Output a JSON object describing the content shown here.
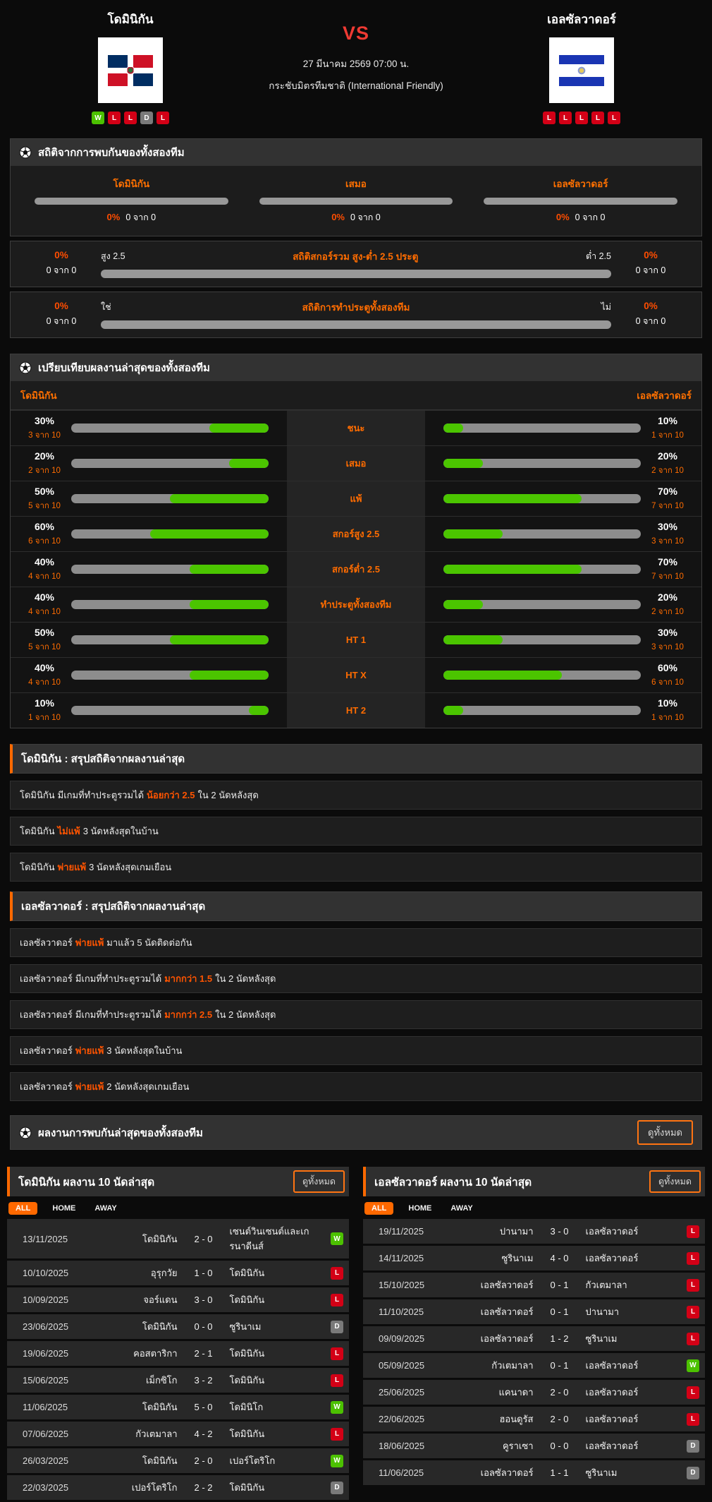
{
  "colors": {
    "accent": "#ff6900",
    "percent": "#ff4d00",
    "win": "#4cc101",
    "loss": "#d30016",
    "draw": "#7a7a7a",
    "bar_green": "#4bc500",
    "bar_gray": "#8d8d8d",
    "vs_red": "#ef3a33"
  },
  "header": {
    "home": {
      "name": "โดมินิกัน",
      "form": [
        {
          "r": "W"
        },
        {
          "r": "L"
        },
        {
          "r": "L"
        },
        {
          "r": "D"
        },
        {
          "r": "L"
        }
      ]
    },
    "away": {
      "name": "เอลซัลวาดอร์",
      "form": [
        {
          "r": "L"
        },
        {
          "r": "L"
        },
        {
          "r": "L"
        },
        {
          "r": "L"
        },
        {
          "r": "L"
        }
      ]
    },
    "vs": "VS",
    "datetime": "27 มีนาคม 2569 07:00 น.",
    "competition": "กระชับมิตรทีมชาติ (International Friendly)"
  },
  "h2h": {
    "title": "สถิติจากการพบกันของทั้งสองทีม",
    "cols": [
      {
        "label": "โดมินิกัน",
        "pct": 0,
        "pct_label": "0%",
        "count": "0 จาก 0"
      },
      {
        "label": "เสมอ",
        "pct": 0,
        "pct_label": "0%",
        "count": "0 จาก 0"
      },
      {
        "label": "เอลซัลวาดอร์",
        "pct": 0,
        "pct_label": "0%",
        "count": "0 จาก 0"
      }
    ],
    "ou": {
      "title": "สถิติสกอร์รวม สูง-ต่ำ 2.5 ประตู",
      "left_label": "สูง 2.5",
      "right_label": "ต่ำ 2.5",
      "left_pct": 0,
      "left_pct_label": "0%",
      "left_count": "0 จาก 0",
      "right_pct": 0,
      "right_pct_label": "0%",
      "right_count": "0 จาก 0"
    },
    "btts": {
      "title": "สถิติการทำประตูทั้งสองทีม",
      "left_label": "ใช่",
      "right_label": "ไม่",
      "left_pct": 0,
      "left_pct_label": "0%",
      "left_count": "0 จาก 0",
      "right_pct": 0,
      "right_pct_label": "0%",
      "right_count": "0 จาก 0"
    }
  },
  "compare": {
    "title": "เปรียบเทียบผลงานล่าสุดของทั้งสองทีม",
    "home_label": "โดมินิกัน",
    "away_label": "เอลซัลวาดอร์",
    "rows": [
      {
        "label": "ชนะ",
        "home_pct": 30,
        "home_pct_label": "30%",
        "home_count": "3 จาก 10",
        "away_pct": 10,
        "away_pct_label": "10%",
        "away_count": "1 จาก 10"
      },
      {
        "label": "เสมอ",
        "home_pct": 20,
        "home_pct_label": "20%",
        "home_count": "2 จาก 10",
        "away_pct": 20,
        "away_pct_label": "20%",
        "away_count": "2 จาก 10"
      },
      {
        "label": "แพ้",
        "home_pct": 50,
        "home_pct_label": "50%",
        "home_count": "5 จาก 10",
        "away_pct": 70,
        "away_pct_label": "70%",
        "away_count": "7 จาก 10"
      },
      {
        "label": "สกอร์สูง 2.5",
        "home_pct": 60,
        "home_pct_label": "60%",
        "home_count": "6 จาก 10",
        "away_pct": 30,
        "away_pct_label": "30%",
        "away_count": "3 จาก 10"
      },
      {
        "label": "สกอร์ต่ำ 2.5",
        "home_pct": 40,
        "home_pct_label": "40%",
        "home_count": "4 จาก 10",
        "away_pct": 70,
        "away_pct_label": "70%",
        "away_count": "7 จาก 10"
      },
      {
        "label": "ทำประตูทั้งสองทีม",
        "home_pct": 40,
        "home_pct_label": "40%",
        "home_count": "4 จาก 10",
        "away_pct": 20,
        "away_pct_label": "20%",
        "away_count": "2 จาก 10"
      },
      {
        "label": "HT 1",
        "home_pct": 50,
        "home_pct_label": "50%",
        "home_count": "5 จาก 10",
        "away_pct": 30,
        "away_pct_label": "30%",
        "away_count": "3 จาก 10"
      },
      {
        "label": "HT X",
        "home_pct": 40,
        "home_pct_label": "40%",
        "home_count": "4 จาก 10",
        "away_pct": 60,
        "away_pct_label": "60%",
        "away_count": "6 จาก 10"
      },
      {
        "label": "HT 2",
        "home_pct": 10,
        "home_pct_label": "10%",
        "home_count": "1 จาก 10",
        "away_pct": 10,
        "away_pct_label": "10%",
        "away_count": "1 จาก 10"
      }
    ]
  },
  "summary_home": {
    "title": "โดมินิกัน : สรุปสถิติจากผลงานล่าสุด",
    "rows": [
      {
        "team": "โดมินิกัน",
        "pre": "มีเกมที่ทำประตูรวมได้",
        "hl": "น้อยกว่า 2.5",
        "post": "ใน 2 นัดหลังสุด"
      },
      {
        "team": "โดมินิกัน",
        "pre": "",
        "hl": "ไม่แพ้",
        "post": "3 นัดหลังสุดในบ้าน"
      },
      {
        "team": "โดมินิกัน",
        "pre": "",
        "hl": "พ่ายแพ้",
        "post": "3 นัดหลังสุดเกมเยือน"
      }
    ]
  },
  "summary_away": {
    "title": "เอลซัลวาดอร์ : สรุปสถิติจากผลงานล่าสุด",
    "rows": [
      {
        "team": "เอลซัลวาดอร์",
        "pre": "",
        "hl": "พ่ายแพ้",
        "post": "มาแล้ว 5 นัดติดต่อกัน"
      },
      {
        "team": "เอลซัลวาดอร์",
        "pre": "มีเกมที่ทำประตูรวมได้",
        "hl": "มากกว่า 1.5",
        "post": "ใน 2 นัดหลังสุด"
      },
      {
        "team": "เอลซัลวาดอร์",
        "pre": "มีเกมที่ทำประตูรวมได้",
        "hl": "มากกว่า 2.5",
        "post": "ใน 2 นัดหลังสุด"
      },
      {
        "team": "เอลซัลวาดอร์",
        "pre": "",
        "hl": "พ่ายแพ้",
        "post": "3 นัดหลังสุดในบ้าน"
      },
      {
        "team": "เอลซัลวาดอร์",
        "pre": "",
        "hl": "พ่ายแพ้",
        "post": "2 นัดหลังสุดเกมเยือน"
      }
    ]
  },
  "results_header": {
    "title": "ผลงานการพบกันล่าสุดของทั้งสองทีม",
    "view_all": "ดูทั้งหมด"
  },
  "table_home": {
    "title": "โดมินิกัน ผลงาน 10 นัดล่าสุด",
    "view_all": "ดูทั้งหมด",
    "tabs": [
      {
        "label": "ALL",
        "cls": "active"
      },
      {
        "label": "HOME",
        "cls": ""
      },
      {
        "label": "AWAY",
        "cls": ""
      }
    ],
    "rows": [
      {
        "date": "13/11/2025",
        "home": "โดมินิกัน",
        "score": "2 - 0",
        "away": "เซนต์วินเซนต์และเกรนาดีนส์",
        "result": "W"
      },
      {
        "date": "10/10/2025",
        "home": "อุรุกวัย",
        "score": "1 - 0",
        "away": "โดมินิกัน",
        "result": "L"
      },
      {
        "date": "10/09/2025",
        "home": "จอร์แดน",
        "score": "3 - 0",
        "away": "โดมินิกัน",
        "result": "L"
      },
      {
        "date": "23/06/2025",
        "home": "โดมินิกัน",
        "score": "0 - 0",
        "away": "ซูรินาเม",
        "result": "D"
      },
      {
        "date": "19/06/2025",
        "home": "คอสตาริกา",
        "score": "2 - 1",
        "away": "โดมินิกัน",
        "result": "L"
      },
      {
        "date": "15/06/2025",
        "home": "เม็กซิโก",
        "score": "3 - 2",
        "away": "โดมินิกัน",
        "result": "L"
      },
      {
        "date": "11/06/2025",
        "home": "โดมินิกัน",
        "score": "5 - 0",
        "away": "โดมินิโก",
        "result": "W"
      },
      {
        "date": "07/06/2025",
        "home": "กัวเตมาลา",
        "score": "4 - 2",
        "away": "โดมินิกัน",
        "result": "L"
      },
      {
        "date": "26/03/2025",
        "home": "โดมินิกัน",
        "score": "2 - 0",
        "away": "เปอร์โตริโก",
        "result": "W"
      },
      {
        "date": "22/03/2025",
        "home": "เปอร์โตริโก",
        "score": "2 - 2",
        "away": "โดมินิกัน",
        "result": "D"
      }
    ]
  },
  "table_away": {
    "title": "เอลซัลวาดอร์ ผลงาน 10 นัดล่าสุด",
    "view_all": "ดูทั้งหมด",
    "tabs": [
      {
        "label": "ALL",
        "cls": "active"
      },
      {
        "label": "HOME",
        "cls": ""
      },
      {
        "label": "AWAY",
        "cls": ""
      }
    ],
    "rows": [
      {
        "date": "19/11/2025",
        "home": "ปานามา",
        "score": "3 - 0",
        "away": "เอลซัลวาดอร์",
        "result": "L"
      },
      {
        "date": "14/11/2025",
        "home": "ซูรินาเม",
        "score": "4 - 0",
        "away": "เอลซัลวาดอร์",
        "result": "L"
      },
      {
        "date": "15/10/2025",
        "home": "เอลซัลวาดอร์",
        "score": "0 - 1",
        "away": "กัวเตมาลา",
        "result": "L"
      },
      {
        "date": "11/10/2025",
        "home": "เอลซัลวาดอร์",
        "score": "0 - 1",
        "away": "ปานามา",
        "result": "L"
      },
      {
        "date": "09/09/2025",
        "home": "เอลซัลวาดอร์",
        "score": "1 - 2",
        "away": "ซูรินาเม",
        "result": "L"
      },
      {
        "date": "05/09/2025",
        "home": "กัวเตมาลา",
        "score": "0 - 1",
        "away": "เอลซัลวาดอร์",
        "result": "W"
      },
      {
        "date": "25/06/2025",
        "home": "แคนาดา",
        "score": "2 - 0",
        "away": "เอลซัลวาดอร์",
        "result": "L"
      },
      {
        "date": "22/06/2025",
        "home": "ฮอนดูรัส",
        "score": "2 - 0",
        "away": "เอลซัลวาดอร์",
        "result": "L"
      },
      {
        "date": "18/06/2025",
        "home": "คูราเซา",
        "score": "0 - 0",
        "away": "เอลซัลวาดอร์",
        "result": "D"
      },
      {
        "date": "11/06/2025",
        "home": "เอลซัลวาดอร์",
        "score": "1 - 1",
        "away": "ซูรินาเม",
        "result": "D"
      }
    ]
  }
}
